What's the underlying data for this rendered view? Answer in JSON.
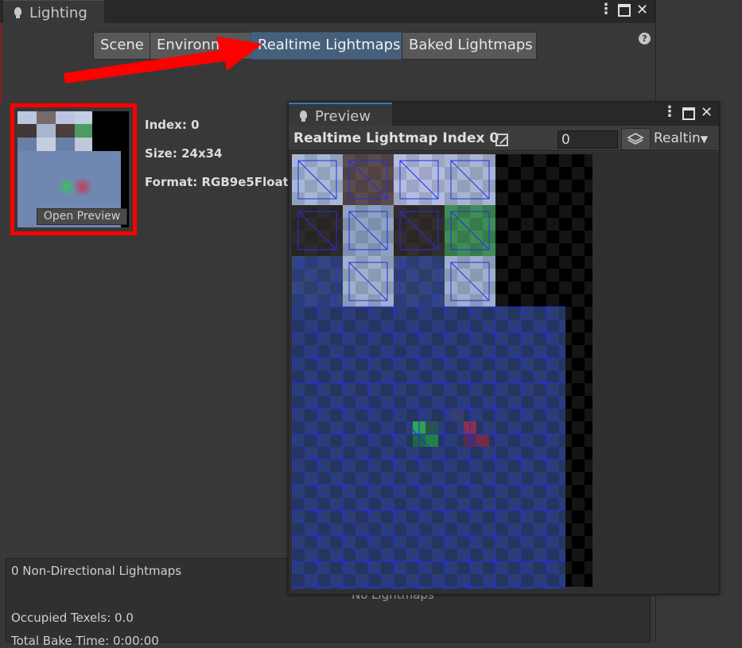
{
  "lighting_window": {
    "tab_title": "Lighting",
    "tab_icon": "lightbulb-icon",
    "menu_icon": "kebab-menu-icon",
    "tabs": [
      {
        "label": "Scene",
        "active": false
      },
      {
        "label": "Environme",
        "active": false
      },
      {
        "label": "Realtime Lightmaps",
        "active": true
      },
      {
        "label": "Baked Lightmaps",
        "active": false
      }
    ],
    "help_icon": "help-icon",
    "lightmap": {
      "index": "Index: 0",
      "size": "Size: 24x34",
      "format": "Format: RGB9e5Float",
      "open_preview_label": "Open Preview"
    },
    "bottom": {
      "directional": "0 Non-Directional Lightmaps",
      "no_lightmaps": "No Lightmaps",
      "occupied": "Occupied Texels: 0.0",
      "bake_time": "Total Bake Time: 0:00:00"
    }
  },
  "preview_window": {
    "tab_title": "Preview",
    "title": "Realtime Lightmap Index 0",
    "index_value": "0",
    "mode_label": "Realtin",
    "icons": {
      "ratio": "aspect-ratio-icon",
      "layers": "layers-icon",
      "dropdown": "triangle-down-icon"
    }
  },
  "colors": {
    "annotation": "#ff0000",
    "active_tab": "#46607c",
    "lightmap_blue": "#2c3e6e",
    "uv_lines": "#1f2fe6"
  }
}
